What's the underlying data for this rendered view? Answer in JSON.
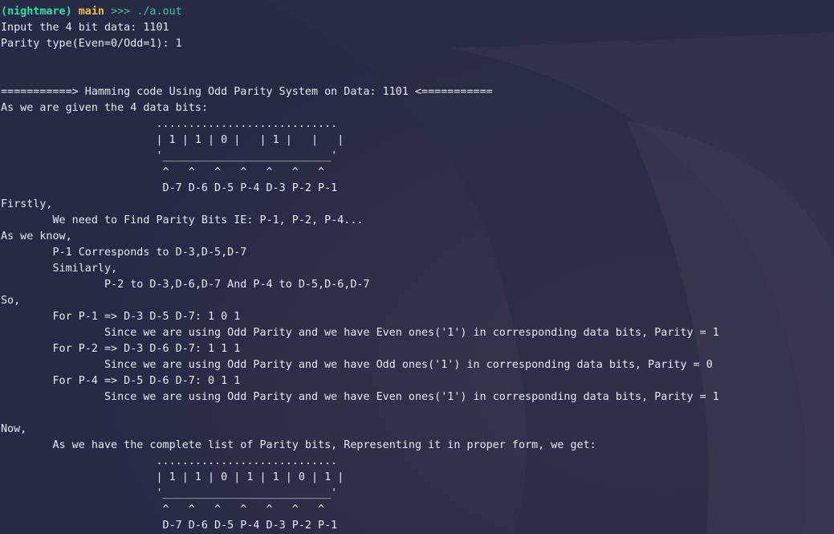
{
  "colors": {
    "background": "#262a45",
    "text": "#e6e8f0",
    "prompt_name": "#31e0a5",
    "prompt_branch": "#f0c040",
    "prompt_command": "#4fc3a1"
  },
  "prompt": {
    "open_paren": "(",
    "env_name": "nightmare",
    "close_paren": ")",
    "branch": "main",
    "arrows": ">>>",
    "command": "./a.out"
  },
  "lines": [
    "Input the 4 bit data: 1101",
    "Parity type(Even=0/Odd=1): 1",
    "",
    "",
    "===========> Hamming code Using Odd Parity System on Data: 1101 <===========",
    "As we are given the 4 data bits:",
    "                        ............................",
    "                        | 1 | 1 | 0 |   | 1 |   |   |",
    "                        '__________________________'",
    "                         ^   ^   ^   ^   ^   ^   ^",
    "                         D-7 D-6 D-5 P-4 D-3 P-2 P-1",
    "Firstly,",
    "        We need to Find Parity Bits IE: P-1, P-2, P-4...",
    "As we know,",
    "        P-1 Corresponds to D-3,D-5,D-7",
    "        Similarly,",
    "                P-2 to D-3,D-6,D-7 And P-4 to D-5,D-6,D-7",
    "So,",
    "        For P-1 => D-3 D-5 D-7: 1 0 1",
    "                Since we are using Odd Parity and we have Even ones('1') in corresponding data bits, Parity = 1",
    "        For P-2 => D-3 D-6 D-7: 1 1 1",
    "                Since we are using Odd Parity and we have Odd ones('1') in corresponding data bits, Parity = 0",
    "        For P-4 => D-5 D-6 D-7: 0 1 1",
    "                Since we are using Odd Parity and we have Even ones('1') in corresponding data bits, Parity = 1",
    "",
    "Now,",
    "        As we have the complete list of Parity bits, Representing it in proper form, we get:",
    "                        ............................",
    "                        | 1 | 1 | 0 | 1 | 1 | 0 | 1 |",
    "                        '__________________________'",
    "                         ^   ^   ^   ^   ^   ^   ^",
    "                         D-7 D-6 D-5 P-4 D-3 P-2 P-1"
  ]
}
